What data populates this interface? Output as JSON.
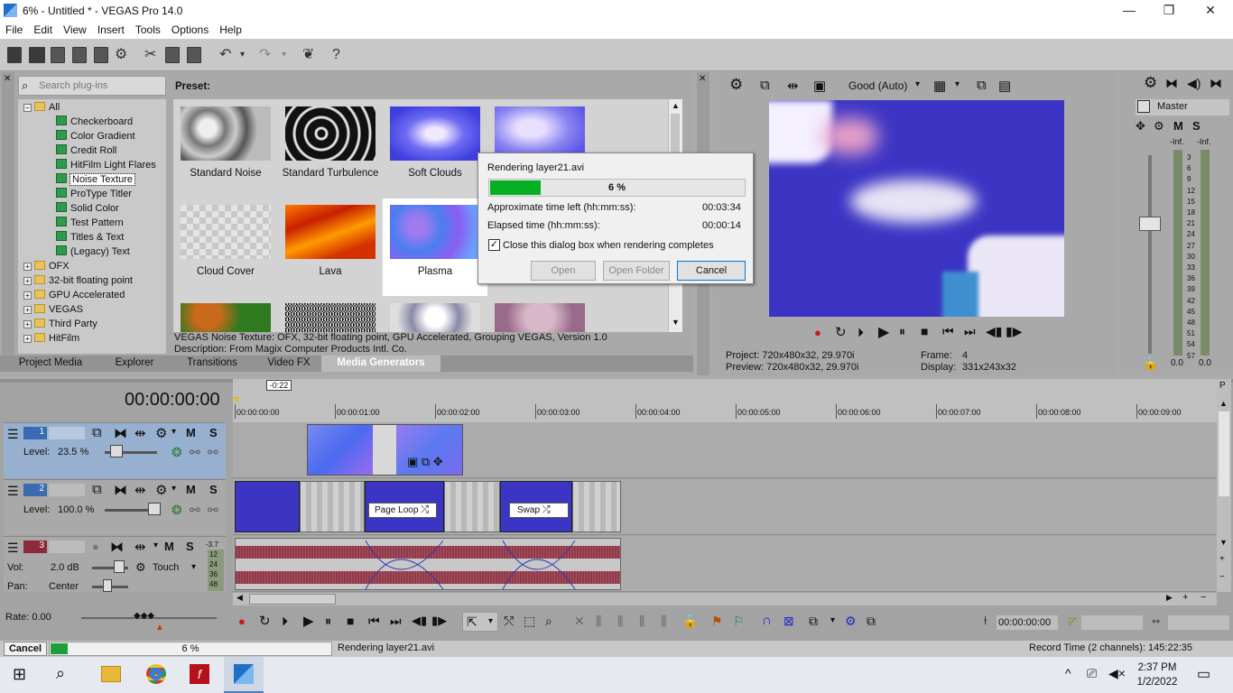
{
  "window": {
    "title": "6% - Untitled * - VEGAS Pro 14.0",
    "min": "—",
    "restore": "❐",
    "close": "✕"
  },
  "menu": [
    "File",
    "Edit",
    "View",
    "Insert",
    "Tools",
    "Options",
    "Help"
  ],
  "explorer": {
    "search_placeholder": "Search plug-ins",
    "preset_label": "Preset:",
    "tree": [
      {
        "label": "All",
        "type": "folder",
        "level": 0,
        "expander": "−"
      },
      {
        "label": "Checkerboard",
        "type": "plug",
        "level": 1
      },
      {
        "label": "Color Gradient",
        "type": "plug",
        "level": 1
      },
      {
        "label": "Credit Roll",
        "type": "plug",
        "level": 1
      },
      {
        "label": "HitFilm Light Flares",
        "type": "plug",
        "level": 1
      },
      {
        "label": "Noise Texture",
        "type": "plug",
        "level": 1,
        "selected": true
      },
      {
        "label": "ProType Titler",
        "type": "plug",
        "level": 1
      },
      {
        "label": "Solid Color",
        "type": "plug",
        "level": 1
      },
      {
        "label": "Test Pattern",
        "type": "plug",
        "level": 1
      },
      {
        "label": "Titles & Text",
        "type": "plug",
        "level": 1
      },
      {
        "label": "(Legacy) Text",
        "type": "plug",
        "level": 1
      },
      {
        "label": "OFX",
        "type": "folder",
        "level": 0,
        "expander": "+"
      },
      {
        "label": "32-bit floating point",
        "type": "folder",
        "level": 0,
        "expander": "+"
      },
      {
        "label": "GPU Accelerated",
        "type": "folder",
        "level": 0,
        "expander": "+"
      },
      {
        "label": "VEGAS",
        "type": "folder",
        "level": 0,
        "expander": "+"
      },
      {
        "label": "Third Party",
        "type": "folder",
        "level": 0,
        "expander": "+"
      },
      {
        "label": "HitFilm",
        "type": "folder",
        "level": 0,
        "expander": "+"
      }
    ],
    "presets": [
      "Standard Noise",
      "Standard Turbulence",
      "Soft Clouds",
      "Cloud Cover",
      "Lava",
      "Plasma"
    ],
    "description_line1": "VEGAS Noise Texture: OFX, 32-bit floating point, GPU Accelerated, Grouping VEGAS, Version 1.0",
    "description_line2": "Description: From Magix Computer Products Intl. Co.",
    "tabs": [
      "Project Media",
      "Explorer",
      "Transitions",
      "Video FX",
      "Media Generators"
    ]
  },
  "dialog": {
    "title": "Rendering layer21.avi",
    "progress_label": "6 %",
    "progress": 0.06,
    "time_left_label": "Approximate time left (hh:mm:ss):",
    "time_left": "00:03:34",
    "elapsed_label": "Elapsed time (hh:mm:ss):",
    "elapsed": "00:00:14",
    "checkbox_label": "Close this dialog box when rendering completes",
    "open": "Open",
    "open_folder": "Open Folder",
    "cancel": "Cancel"
  },
  "preview": {
    "quality": "Good (Auto)",
    "project_label": "Project:",
    "project_value": "720x480x32, 29.970i",
    "preview_label": "Preview:",
    "preview_value": "720x480x32, 29.970i",
    "frame_label": "Frame:",
    "frame_value": "4",
    "display_label": "Display:",
    "display_value": "331x243x32"
  },
  "master": {
    "label": "Master",
    "m": "M",
    "s": "S",
    "inf_left": "-Inf.",
    "inf_right": "-Inf.",
    "scale": [
      "3",
      "6",
      "9",
      "12",
      "15",
      "18",
      "21",
      "24",
      "27",
      "30",
      "33",
      "36",
      "39",
      "42",
      "45",
      "48",
      "51",
      "54",
      "57"
    ],
    "val_left": "0.0",
    "val_right": "0.0"
  },
  "timeline": {
    "timecode": "00:00:00:00",
    "marker": "-0:22",
    "ruler": [
      "00:00:00:00",
      "00:00:01:00",
      "00:00:02:00",
      "00:00:03:00",
      "00:00:04:00",
      "00:00:05:00",
      "00:00:06:00",
      "00:00:07:00",
      "00:00:08:00",
      "00:00:09:00"
    ],
    "tracks": [
      {
        "num": "1",
        "level_label": "Level:",
        "level": "23.5 %"
      },
      {
        "num": "2",
        "level_label": "Level:",
        "level": "100.0 %"
      },
      {
        "num": "3",
        "vol_label": "Vol:",
        "vol": "2.0 dB",
        "pan_label": "Pan:",
        "pan": "Center",
        "touch": "Touch",
        "meter_top": "-3.7",
        "meter": [
          "12",
          "24",
          "36",
          "48"
        ]
      }
    ],
    "transitions": [
      "Page Loop",
      "Swap"
    ],
    "m": "M",
    "s": "S",
    "rate": "Rate: 0.00",
    "bottom_timecode": "00:00:00:00"
  },
  "status": {
    "cancel": "Cancel",
    "progress_label": "6 %",
    "progress": 0.06,
    "message": "Rendering layer21.avi",
    "record_time": "Record Time (2 channels): 145:22:35"
  },
  "taskbar": {
    "time": "2:37 PM",
    "date": "1/2/2022"
  },
  "colors": {
    "accent": "#1f9e3a",
    "video": "#3c35c4",
    "audio_wave": "#8f3a4a"
  }
}
